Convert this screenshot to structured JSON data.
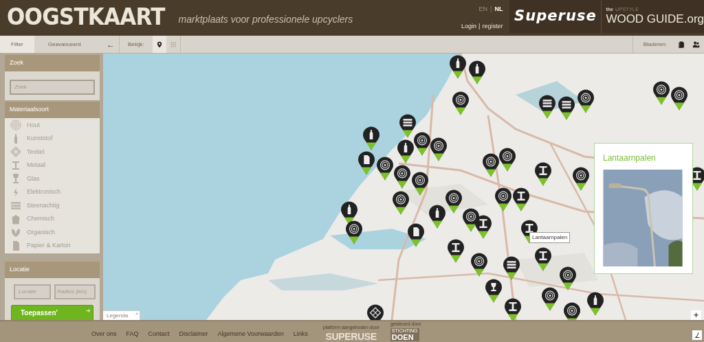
{
  "header": {
    "logo": "OOGSTKAART",
    "tagline": "marktplaats voor professionele upcyclers",
    "languages": [
      {
        "label": "EN",
        "selected": false
      },
      {
        "label": "NL",
        "selected": true
      }
    ],
    "language_separator": "|",
    "login": "Login",
    "account_separator": "|",
    "register": "register",
    "partner_logo": "Superuse",
    "guide_prefix": "the",
    "guide_brand": "UPSTYLE",
    "guide_name": "WOOD GUIDE.org"
  },
  "toolbar": {
    "tabs": [
      {
        "label": "Filter",
        "selected": true
      },
      {
        "label": "Geavanceerd",
        "selected": false
      }
    ],
    "collapse": "←",
    "view_label": "Bekijk:",
    "views": [
      {
        "kind": "map",
        "selected": true
      },
      {
        "kind": "grid",
        "selected": false
      }
    ],
    "browse_label": "Bladeren:"
  },
  "sidebar": {
    "search": {
      "title": "Zoek",
      "placeholder": "Zoek"
    },
    "materials": {
      "title": "Materiaalsoort",
      "items": [
        {
          "kind": "wood",
          "label": "Hout"
        },
        {
          "kind": "bottle",
          "label": "Kunststof"
        },
        {
          "kind": "textile",
          "label": "Textiel"
        },
        {
          "kind": "beam",
          "label": "Metaal"
        },
        {
          "kind": "glass",
          "label": "Glas"
        },
        {
          "kind": "bolt",
          "label": "Elektronisch"
        },
        {
          "kind": "brick",
          "label": "Steenachtig"
        },
        {
          "kind": "bucket",
          "label": "Chemisch"
        },
        {
          "kind": "leaf",
          "label": "Organisch"
        },
        {
          "kind": "paper",
          "label": "Papier & Karton"
        }
      ]
    },
    "location": {
      "title": "Locatie",
      "location_placeholder": "Locatie",
      "radius_placeholder": "Radius (km)",
      "apply": "Toepassen'"
    }
  },
  "map": {
    "tooltip": "Lantaarnpalen",
    "popup": {
      "title": "Lantaarnpalen"
    },
    "legend": "Legenda",
    "zoom_in": "+"
  },
  "footer": {
    "links": [
      "Over ons",
      "FAQ",
      "Contact",
      "Disclaimer",
      "Algemene Voorwaarden",
      "Links"
    ],
    "platform_label": "platform aangeboden door",
    "platform_logo": "SUPERUSE",
    "support_label": "gesteund door",
    "support_logo_top": "STICHTING",
    "support_logo": "DOEN"
  }
}
